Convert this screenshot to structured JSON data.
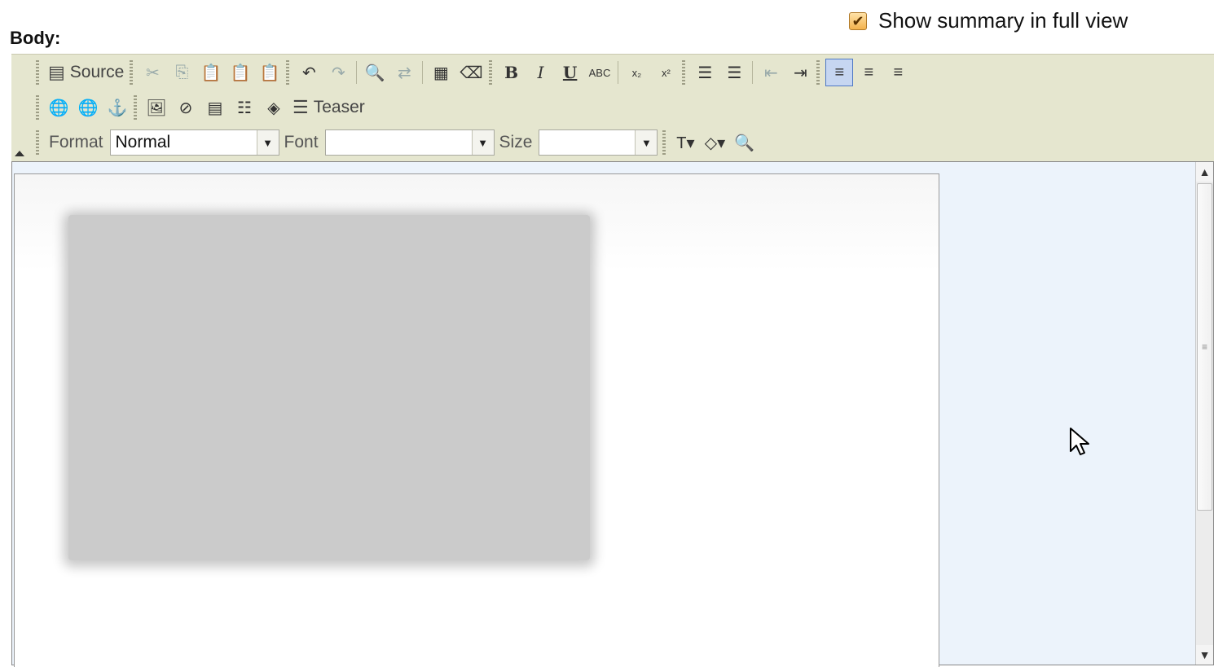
{
  "summary": {
    "checked": true,
    "label": "Show summary in full view"
  },
  "body_label": "Body:",
  "toolbar": {
    "source_label": "Source",
    "teaser_label": "Teaser",
    "format_label": "Format",
    "format_value": "Normal",
    "font_label": "Font",
    "font_value": "",
    "size_label": "Size",
    "size_value": ""
  },
  "icons": {
    "checkbox_glyph": "✔",
    "cut": "✂",
    "copy": "⎘",
    "paste": "📋",
    "undo": "↶",
    "redo": "↷",
    "find": "🔍",
    "replace": "⇄",
    "select_all": "▦",
    "remove_format": "⌫",
    "bold": "B",
    "italic": "I",
    "underline": "U",
    "strike": "ABC",
    "subscript": "x₂",
    "superscript": "x²",
    "ordered_list": "☰",
    "unordered_list": "☰",
    "outdent": "⇤",
    "indent": "⇥",
    "align_left": "≡",
    "align_center": "≡",
    "align_right": "≡",
    "link": "🌐",
    "unlink": "🌐",
    "anchor": "⚓",
    "image": "🖼",
    "flash": "⊘",
    "table": "▤",
    "hr": "☷",
    "special": "◈",
    "teaser": "☰",
    "text_color": "T▾",
    "bg_color": "◇▾",
    "preview": "🔍",
    "arrow_down": "▼",
    "scroll_up": "▲",
    "scroll_down": "▼",
    "scroll_grip": "≡"
  }
}
